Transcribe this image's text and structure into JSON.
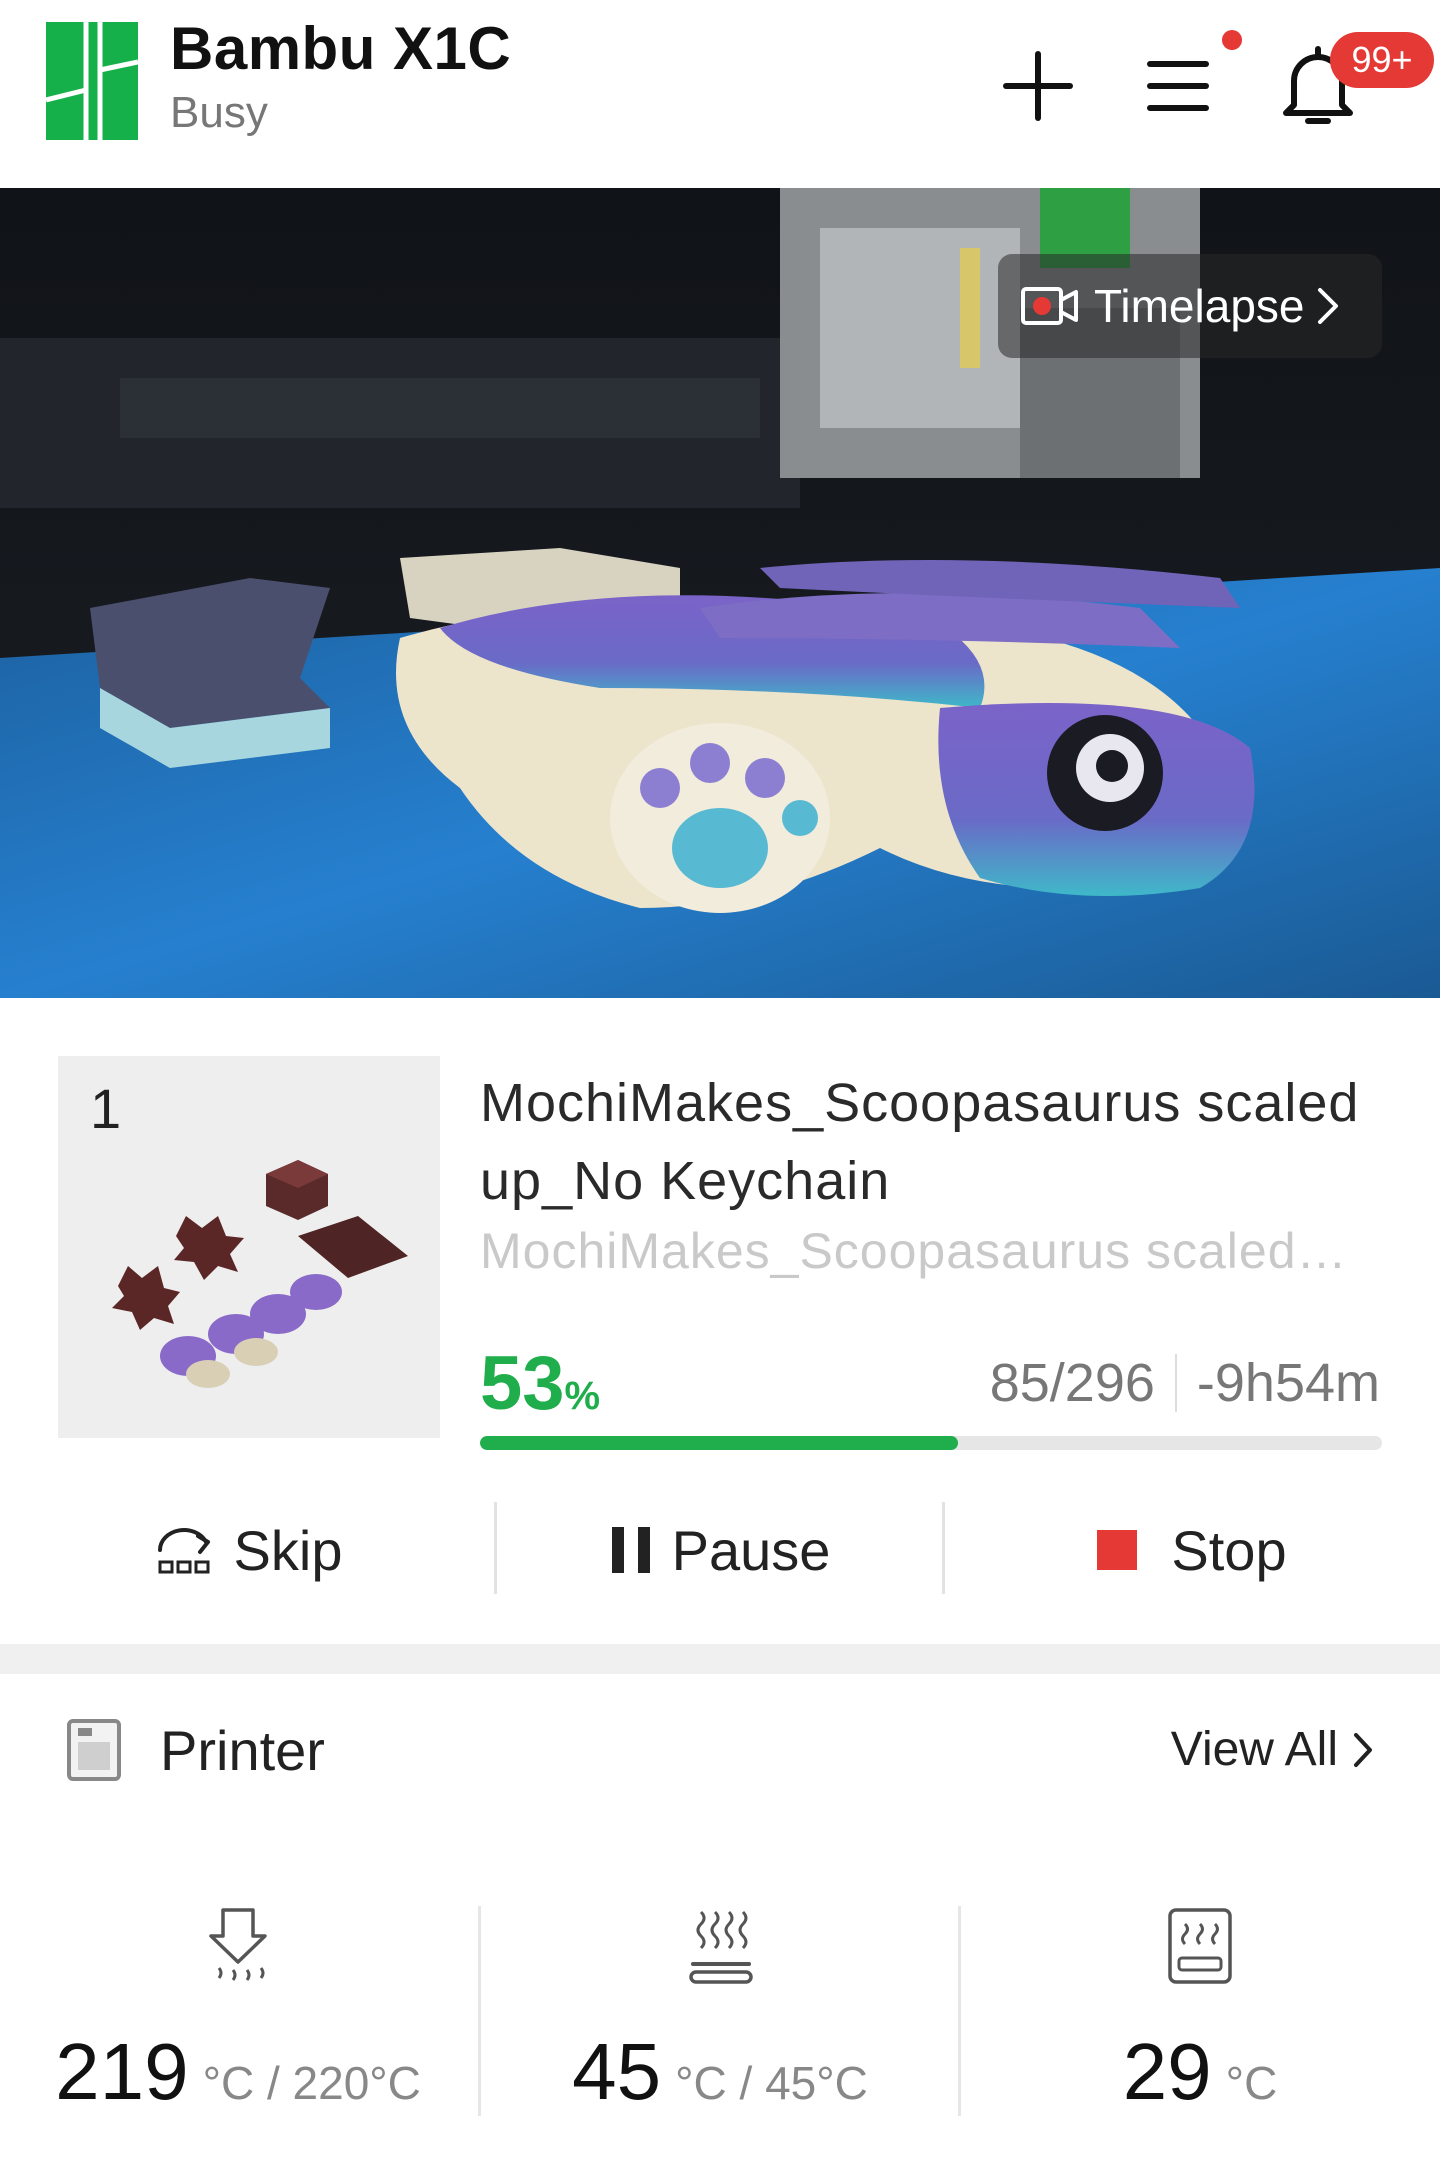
{
  "header": {
    "printer_name": "Bambu X1C",
    "status": "Busy",
    "notification_count": "99+",
    "brand_color": "#16b04b"
  },
  "camera": {
    "timelapse_label": "Timelapse"
  },
  "job": {
    "plate_index": "1",
    "title": "MochiMakes_Scoopasaurus scaled up_No Keychain",
    "subtitle": "MochiMakes_Scoopasaurus scaled…",
    "progress_value": "53",
    "progress_unit": "%",
    "progress_fraction": 0.53,
    "layers": "85/296",
    "remaining": "-9h54m",
    "progress_color": "#1fae4b"
  },
  "actions": {
    "skip": "Skip",
    "pause": "Pause",
    "stop": "Stop",
    "stop_color": "#e53935"
  },
  "printer_section": {
    "title": "Printer",
    "view_all": "View All",
    "temps": [
      {
        "icon": "nozzle-temperature-icon",
        "value": "219",
        "unit": "°C / 220°C"
      },
      {
        "icon": "heatbed-temperature-icon",
        "value": "45",
        "unit": "°C / 45°C"
      },
      {
        "icon": "chamber-temperature-icon",
        "value": "29",
        "unit": "°C"
      }
    ]
  }
}
